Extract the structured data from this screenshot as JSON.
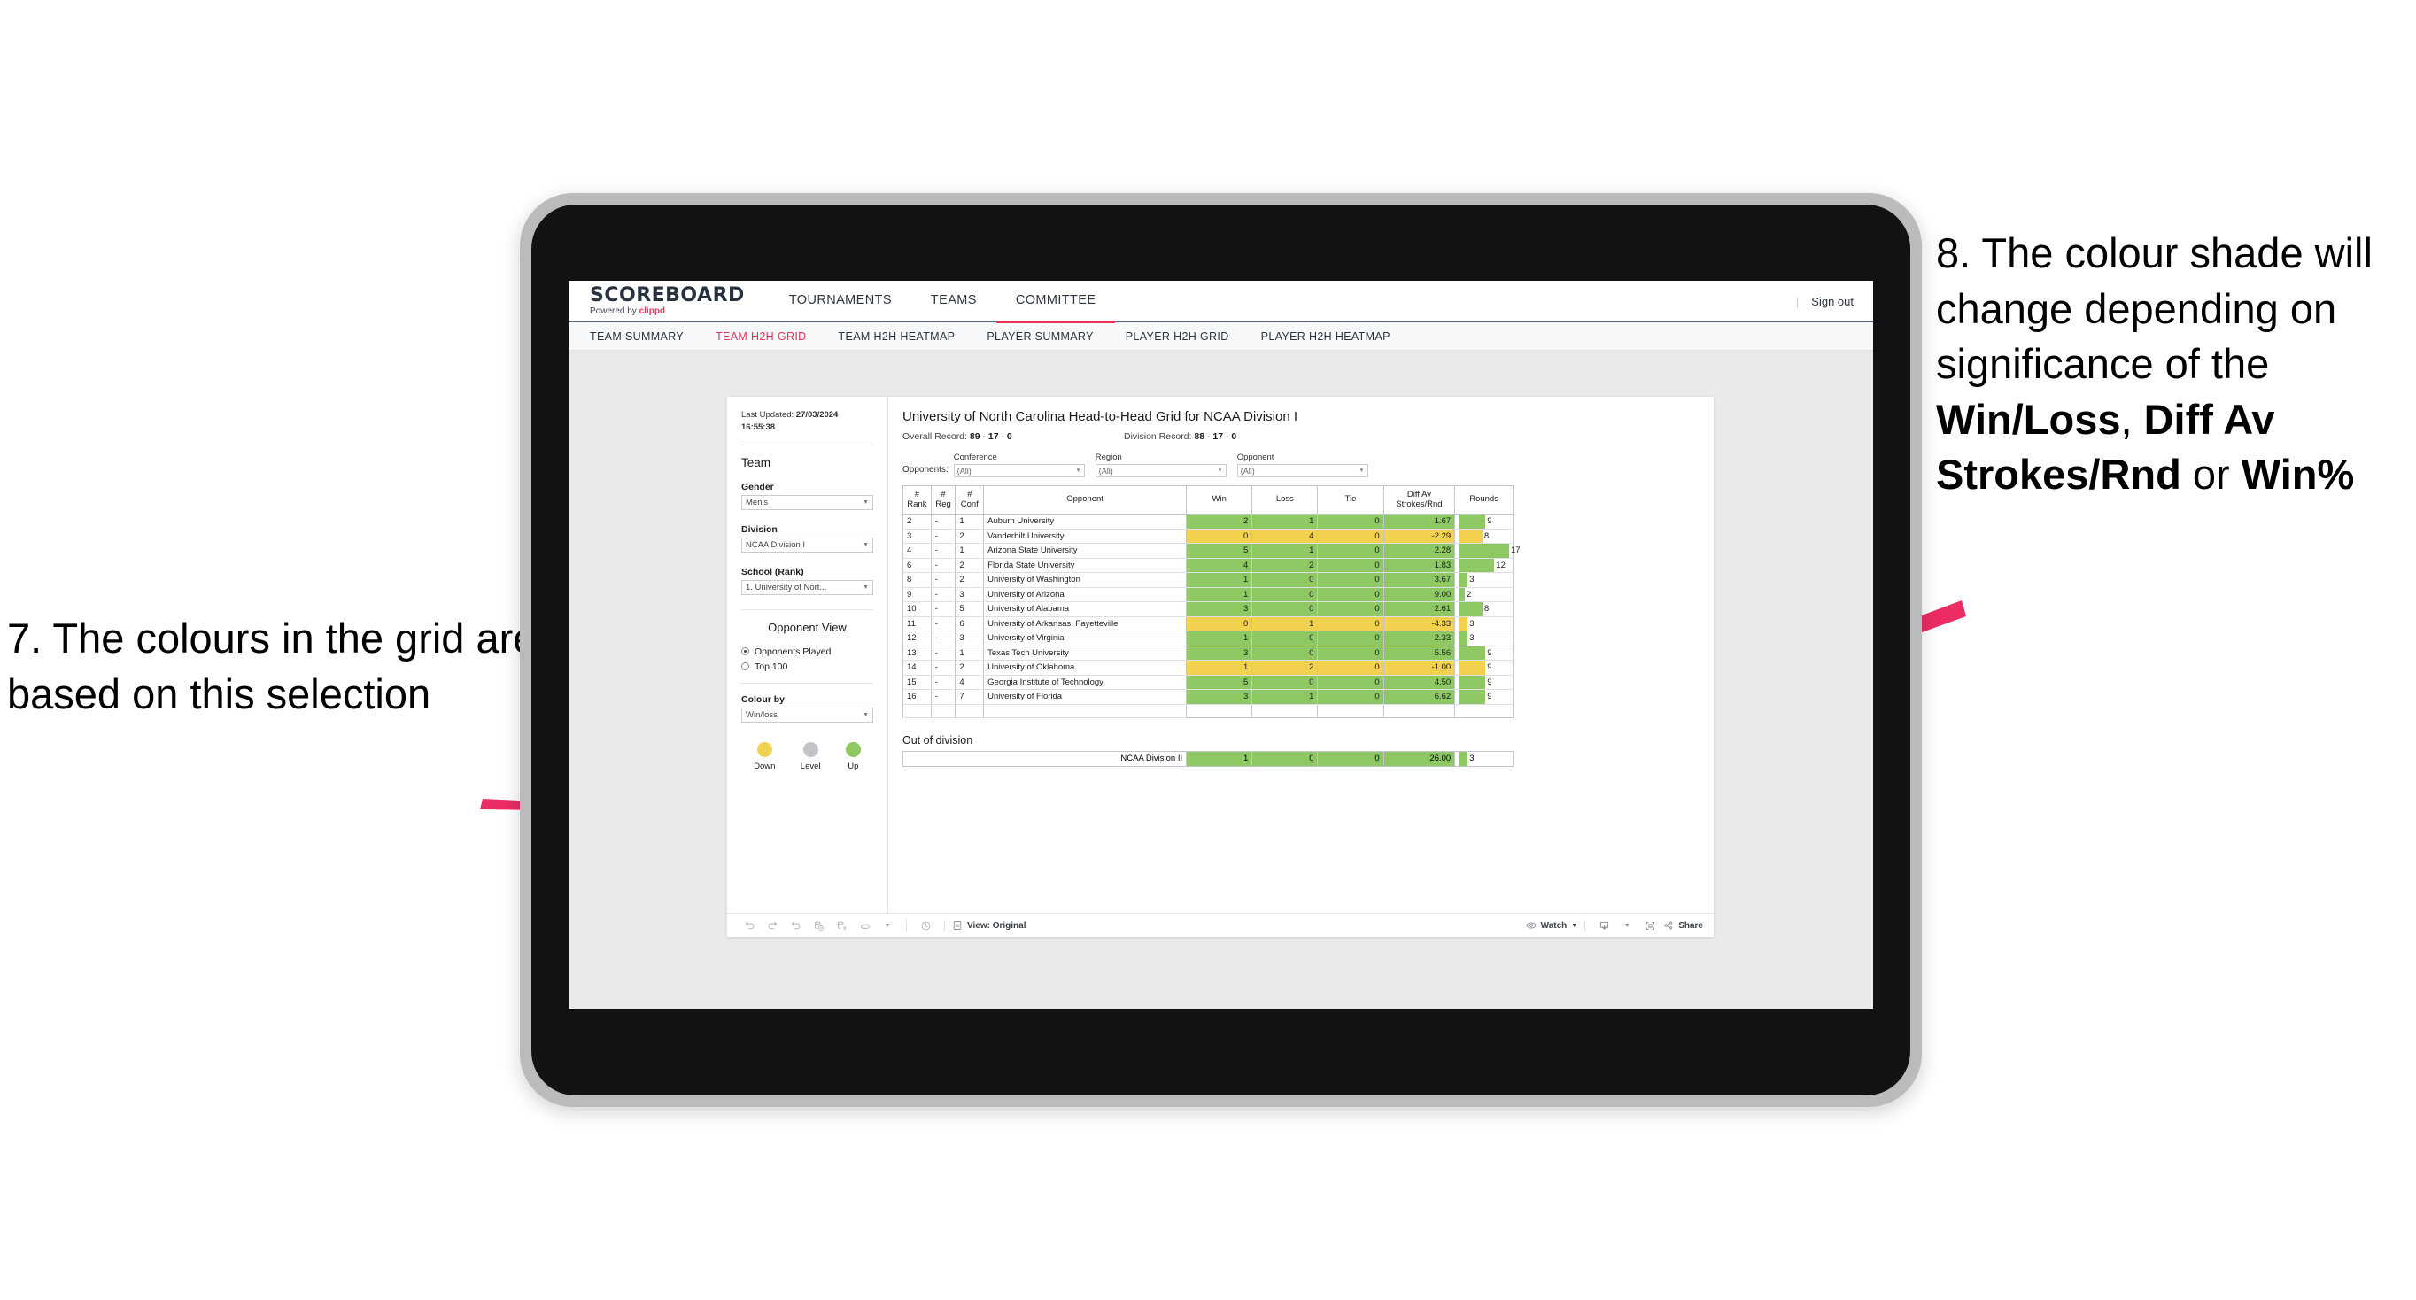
{
  "annotations": {
    "left": "7. The colours in the grid are based on this selection",
    "right_parts": {
      "p1": "8. The colour shade will change depending on significance of the ",
      "b1": "Win/Loss",
      "p2": ", ",
      "b2": "Diff Av Strokes/Rnd",
      "p3": " or ",
      "b3": "Win%"
    },
    "arrow_color": "#eb2d64"
  },
  "app": {
    "brand": {
      "name": "SCOREBOARD",
      "sub_prefix": "Powered by ",
      "sub_brand": "clippd"
    },
    "top_nav": [
      {
        "label": "TOURNAMENTS",
        "active": false
      },
      {
        "label": "TEAMS",
        "active": false
      },
      {
        "label": "COMMITTEE",
        "active": true
      }
    ],
    "sign_out": "Sign out",
    "sub_nav": [
      {
        "label": "TEAM SUMMARY",
        "active": false
      },
      {
        "label": "TEAM H2H GRID",
        "active": true
      },
      {
        "label": "TEAM H2H HEATMAP",
        "active": false
      },
      {
        "label": "PLAYER SUMMARY",
        "active": false
      },
      {
        "label": "PLAYER H2H GRID",
        "active": false
      },
      {
        "label": "PLAYER H2H HEATMAP",
        "active": false
      }
    ]
  },
  "sidebar": {
    "last_updated_label": "Last Updated: ",
    "last_updated_value": "27/03/2024 16:55:38",
    "team_heading": "Team",
    "gender_label": "Gender",
    "gender_value": "Men's",
    "division_label": "Division",
    "division_value": "NCAA Division I",
    "school_label": "School (Rank)",
    "school_value": "1. University of Nort...",
    "opponent_view_heading": "Opponent View",
    "opponent_view_options": [
      {
        "label": "Opponents Played",
        "selected": true
      },
      {
        "label": "Top 100",
        "selected": false
      }
    ],
    "colour_by_label": "Colour by",
    "colour_by_value": "Win/loss",
    "legend": [
      {
        "label": "Down",
        "color": "#f2d14e"
      },
      {
        "label": "Level",
        "color": "#c1c3c8"
      },
      {
        "label": "Up",
        "color": "#8dc863"
      }
    ]
  },
  "main": {
    "title": "University of North Carolina Head-to-Head Grid for NCAA Division I",
    "overall_record_label": "Overall Record: ",
    "overall_record_value": "89 - 17 - 0",
    "division_record_label": "Division Record: ",
    "division_record_value": "88 - 17 - 0",
    "opponents_label": "Opponents:",
    "filters": [
      {
        "label": "Conference",
        "value": "(All)"
      },
      {
        "label": "Region",
        "value": "(All)"
      },
      {
        "label": "Opponent",
        "value": "(All)"
      }
    ],
    "out_of_division_title": "Out of division"
  },
  "chart_data": {
    "type": "table",
    "title": "University of North Carolina Head-to-Head Grid for NCAA Division I",
    "columns": [
      "# Rank",
      "# Reg",
      "# Conf",
      "Opponent",
      "Win",
      "Loss",
      "Tie",
      "Diff Av Strokes/Rnd",
      "Rounds"
    ],
    "colour_scale": {
      "up": "#8dc863",
      "down": "#f2d14e",
      "level": "#c1c3c8"
    },
    "rounds_max": 17,
    "rows": [
      {
        "rank": "2",
        "reg": "-",
        "conf": "1",
        "opponent": "Auburn University",
        "win": "2",
        "loss": "1",
        "tie": "0",
        "diff": "1.67",
        "rounds": "9",
        "rounds_n": 9,
        "state": "up"
      },
      {
        "rank": "3",
        "reg": "-",
        "conf": "2",
        "opponent": "Vanderbilt University",
        "win": "0",
        "loss": "4",
        "tie": "0",
        "diff": "-2.29",
        "rounds": "8",
        "rounds_n": 8,
        "state": "down"
      },
      {
        "rank": "4",
        "reg": "-",
        "conf": "1",
        "opponent": "Arizona State University",
        "win": "5",
        "loss": "1",
        "tie": "0",
        "diff": "2.28",
        "rounds": "17",
        "rounds_n": 17,
        "state": "up"
      },
      {
        "rank": "6",
        "reg": "-",
        "conf": "2",
        "opponent": "Florida State University",
        "win": "4",
        "loss": "2",
        "tie": "0",
        "diff": "1.83",
        "rounds": "12",
        "rounds_n": 12,
        "state": "up"
      },
      {
        "rank": "8",
        "reg": "-",
        "conf": "2",
        "opponent": "University of Washington",
        "win": "1",
        "loss": "0",
        "tie": "0",
        "diff": "3.67",
        "rounds": "3",
        "rounds_n": 3,
        "state": "up"
      },
      {
        "rank": "9",
        "reg": "-",
        "conf": "3",
        "opponent": "University of Arizona",
        "win": "1",
        "loss": "0",
        "tie": "0",
        "diff": "9.00",
        "rounds": "2",
        "rounds_n": 2,
        "state": "up"
      },
      {
        "rank": "10",
        "reg": "-",
        "conf": "5",
        "opponent": "University of Alabama",
        "win": "3",
        "loss": "0",
        "tie": "0",
        "diff": "2.61",
        "rounds": "8",
        "rounds_n": 8,
        "state": "up"
      },
      {
        "rank": "11",
        "reg": "-",
        "conf": "6",
        "opponent": "University of Arkansas, Fayetteville",
        "win": "0",
        "loss": "1",
        "tie": "0",
        "diff": "-4.33",
        "rounds": "3",
        "rounds_n": 3,
        "state": "down"
      },
      {
        "rank": "12",
        "reg": "-",
        "conf": "3",
        "opponent": "University of Virginia",
        "win": "1",
        "loss": "0",
        "tie": "0",
        "diff": "2.33",
        "rounds": "3",
        "rounds_n": 3,
        "state": "up"
      },
      {
        "rank": "13",
        "reg": "-",
        "conf": "1",
        "opponent": "Texas Tech University",
        "win": "3",
        "loss": "0",
        "tie": "0",
        "diff": "5.56",
        "rounds": "9",
        "rounds_n": 9,
        "state": "up"
      },
      {
        "rank": "14",
        "reg": "-",
        "conf": "2",
        "opponent": "University of Oklahoma",
        "win": "1",
        "loss": "2",
        "tie": "0",
        "diff": "-1.00",
        "rounds": "9",
        "rounds_n": 9,
        "state": "down"
      },
      {
        "rank": "15",
        "reg": "-",
        "conf": "4",
        "opponent": "Georgia Institute of Technology",
        "win": "5",
        "loss": "0",
        "tie": "0",
        "diff": "4.50",
        "rounds": "9",
        "rounds_n": 9,
        "state": "up"
      },
      {
        "rank": "16",
        "reg": "-",
        "conf": "7",
        "opponent": "University of Florida",
        "win": "3",
        "loss": "1",
        "tie": "0",
        "diff": "6.62",
        "rounds": "9",
        "rounds_n": 9,
        "state": "up"
      }
    ],
    "out_of_division_rows": [
      {
        "opponent": "NCAA Division II",
        "win": "1",
        "loss": "0",
        "tie": "0",
        "diff": "26.00",
        "rounds": "3",
        "rounds_n": 3,
        "state": "up"
      }
    ]
  },
  "toolbar": {
    "icons": [
      "undo-icon",
      "redo-icon",
      "revert-icon",
      "refresh-data-icon",
      "pause-updates-icon",
      "alerts-icon"
    ],
    "view_label": "View: Original",
    "watch_label": "Watch",
    "share_label": "Share"
  }
}
